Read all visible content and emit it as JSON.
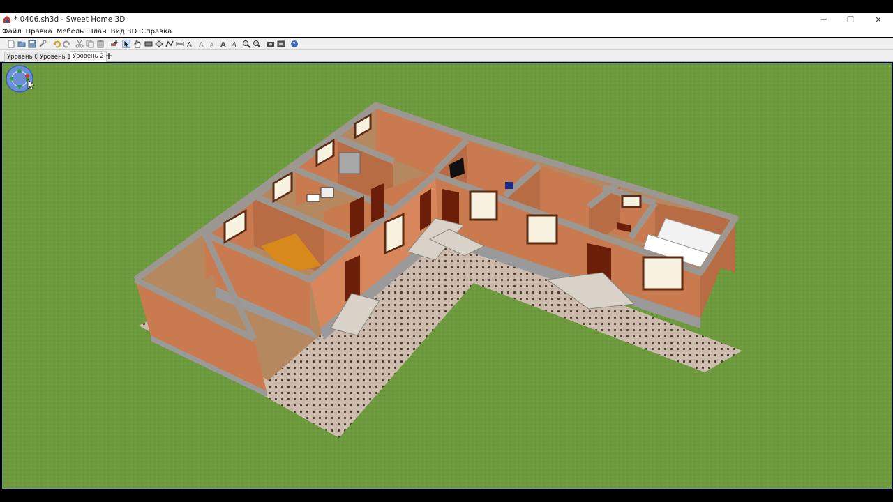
{
  "window": {
    "title": "* 0406.sh3d - Sweet Home 3D",
    "controls": {
      "minimize": "—",
      "restore": "❐",
      "close": "✕"
    }
  },
  "menu": {
    "items": [
      "Файл",
      "Правка",
      "Мебель",
      "План",
      "Вид 3D",
      "Справка"
    ]
  },
  "toolbar": {
    "buttons": [
      {
        "name": "new-home",
        "icon": "new-file-icon"
      },
      {
        "name": "open",
        "icon": "folder-open-icon"
      },
      {
        "name": "save",
        "icon": "save-icon"
      },
      {
        "name": "preferences",
        "icon": "wrench-icon"
      },
      {
        "name": "undo",
        "icon": "undo-icon"
      },
      {
        "name": "redo",
        "icon": "redo-icon"
      },
      {
        "name": "cut",
        "icon": "scissors-icon"
      },
      {
        "name": "copy",
        "icon": "copy-icon"
      },
      {
        "name": "paste",
        "icon": "paste-icon"
      },
      {
        "name": "add-furniture",
        "icon": "add-furniture-icon"
      },
      {
        "name": "select-mode",
        "icon": "arrow-pointer-icon",
        "selected": true
      },
      {
        "name": "pan-mode",
        "icon": "hand-icon"
      },
      {
        "name": "create-walls",
        "icon": "wall-icon"
      },
      {
        "name": "create-rooms",
        "icon": "room-icon"
      },
      {
        "name": "create-polylines",
        "icon": "polyline-icon"
      },
      {
        "name": "create-dimensions",
        "icon": "dimension-icon"
      },
      {
        "name": "create-labels",
        "icon": "label-icon"
      },
      {
        "name": "increase-text",
        "icon": "text-size-up-icon"
      },
      {
        "name": "decrease-text",
        "icon": "text-size-down-icon"
      },
      {
        "name": "bold-text",
        "icon": "bold-text-icon"
      },
      {
        "name": "italic-text",
        "icon": "italic-text-icon"
      },
      {
        "name": "zoom-in",
        "icon": "zoom-in-icon"
      },
      {
        "name": "zoom-out",
        "icon": "zoom-out-icon"
      },
      {
        "name": "create-photo",
        "icon": "camera-icon"
      },
      {
        "name": "create-video",
        "icon": "video-icon"
      },
      {
        "name": "help",
        "icon": "help-icon"
      }
    ]
  },
  "levels": {
    "tabs": [
      "Уровень 0",
      "Уровень 1",
      "Уровень 2"
    ],
    "active": "Уровень 2",
    "add_label": "+"
  },
  "view3d": {
    "navigator": "navigation-compass-icon",
    "colors": {
      "grass": "#6c9a3c",
      "wall_exterior": "#c97a4f",
      "wall_top": "#9c9891",
      "patio": "#c9b7a6"
    }
  }
}
